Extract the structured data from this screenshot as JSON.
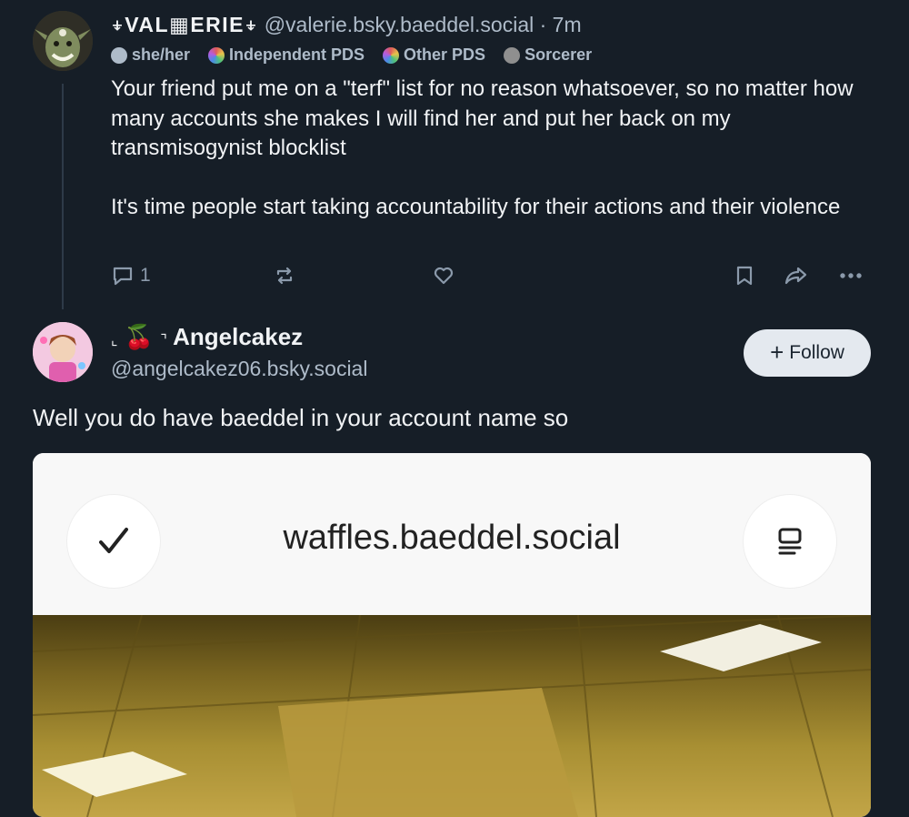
{
  "post1": {
    "display_name": "⍖VAL▦ERIE⍖",
    "handle": "@valerie.bsky.baeddel.social",
    "time": "· 7m",
    "badges": [
      {
        "label": "she/her",
        "icon": "circle-badge-icon"
      },
      {
        "label": "Independent PDS",
        "icon": "pds-rainbow-icon"
      },
      {
        "label": "Other PDS",
        "icon": "pds-rainbow-icon"
      },
      {
        "label": "Sorcerer",
        "icon": "sorcerer-avatar-icon"
      }
    ],
    "text_p1": "Your friend put me on a \"terf\" list for no reason whatsoever, so no matter how many accounts she makes I will find her and put her back on my transmisogynist blocklist",
    "text_p2": "It's time people start taking accountability for their actions and their violence",
    "reply_count": "1"
  },
  "post2": {
    "corner_left": "⌞",
    "emoji": "🍒",
    "corner_right": "⌝",
    "display_name": "Angelcakez",
    "handle": "@angelcakez06.bsky.social",
    "follow_label": "Follow",
    "text": "Well you do have baeddel in your account name so",
    "embed": {
      "url_text": "waffles.baeddel.social"
    }
  },
  "colors": {
    "background": "#161e27",
    "text": "#f1f3f5",
    "muted": "#aebbc9",
    "icon": "#8b9aab",
    "follow_bg": "#e4e9ef"
  }
}
